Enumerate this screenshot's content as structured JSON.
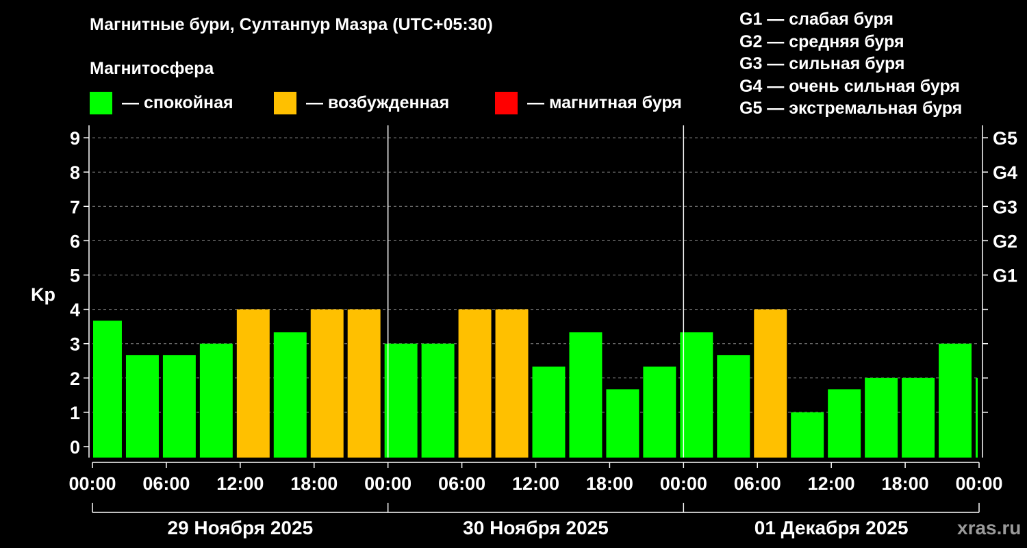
{
  "title": "Магнитные бури, Султанпур Мазра (UTC+05:30)",
  "subtitle": "Магнитосфера",
  "legend": [
    {
      "color": "#00ff00",
      "label": "— спокойная"
    },
    {
      "color": "#ffc000",
      "label": "— возбужденная"
    },
    {
      "color": "#ff0000",
      "label": "— магнитная буря"
    }
  ],
  "g_legend": [
    "G1 — слабая буря",
    "G2 — средняя буря",
    "G3 — сильная буря",
    "G4 — очень сильная буря",
    "G5 — экстремальная буря"
  ],
  "source": "xras.ru",
  "chart_data": {
    "type": "bar",
    "ylabel": "Kp",
    "ylim": [
      0,
      9
    ],
    "yticks": [
      "0",
      "1",
      "2",
      "3",
      "4",
      "5",
      "6",
      "7",
      "8",
      "9"
    ],
    "right_ticks": [
      {
        "value": 5,
        "label": "G1"
      },
      {
        "value": 6,
        "label": "G2"
      },
      {
        "value": 7,
        "label": "G3"
      },
      {
        "value": 8,
        "label": "G4"
      },
      {
        "value": 9,
        "label": "G5"
      }
    ],
    "grid": "horizontal dashed at each Kp level above 0",
    "xtick_labels": [
      "00:00",
      "06:00",
      "12:00",
      "18:00",
      "00:00",
      "06:00",
      "12:00",
      "18:00",
      "00:00",
      "06:00",
      "12:00",
      "18:00",
      "00:00"
    ],
    "days": [
      "29 Ноября 2025",
      "30 Ноября 2025",
      "01 Декабря 2025"
    ],
    "bars": [
      {
        "start": "29 Ноября 2025 00:00",
        "kp": 3.67,
        "status": "спокойная"
      },
      {
        "start": "29 Ноября 2025 02:30",
        "kp": 2.67,
        "status": "спокойная"
      },
      {
        "start": "29 Ноября 2025 05:30",
        "kp": 2.67,
        "status": "спокойная"
      },
      {
        "start": "29 Ноября 2025 08:30",
        "kp": 3.0,
        "status": "спокойная"
      },
      {
        "start": "29 Ноября 2025 11:30",
        "kp": 4.0,
        "status": "возбужденная"
      },
      {
        "start": "29 Ноября 2025 14:30",
        "kp": 3.33,
        "status": "спокойная"
      },
      {
        "start": "29 Ноября 2025 17:30",
        "kp": 4.0,
        "status": "возбужденная"
      },
      {
        "start": "29 Ноября 2025 20:30",
        "kp": 4.0,
        "status": "возбужденная"
      },
      {
        "start": "29 Ноября 2025 23:30",
        "kp": 3.0,
        "status": "спокойная"
      },
      {
        "start": "30 Ноября 2025 02:30",
        "kp": 3.0,
        "status": "спокойная"
      },
      {
        "start": "30 Ноября 2025 05:30",
        "kp": 4.0,
        "status": "возбужденная"
      },
      {
        "start": "30 Ноября 2025 08:30",
        "kp": 4.0,
        "status": "возбужденная"
      },
      {
        "start": "30 Ноября 2025 11:30",
        "kp": 2.33,
        "status": "спокойная"
      },
      {
        "start": "30 Ноября 2025 14:30",
        "kp": 3.33,
        "status": "спокойная"
      },
      {
        "start": "30 Ноября 2025 17:30",
        "kp": 1.67,
        "status": "спокойная"
      },
      {
        "start": "30 Ноября 2025 20:30",
        "kp": 2.33,
        "status": "спокойная"
      },
      {
        "start": "30 Ноября 2025 23:30",
        "kp": 3.33,
        "status": "спокойная"
      },
      {
        "start": "01 Декабря 2025 02:30",
        "kp": 2.67,
        "status": "спокойная"
      },
      {
        "start": "01 Декабря 2025 05:30",
        "kp": 4.0,
        "status": "возбужденная"
      },
      {
        "start": "01 Декабря 2025 08:30",
        "kp": 1.0,
        "status": "спокойная"
      },
      {
        "start": "01 Декабря 2025 11:30",
        "kp": 1.67,
        "status": "спокойная"
      },
      {
        "start": "01 Декабря 2025 14:30",
        "kp": 2.0,
        "status": "спокойная"
      },
      {
        "start": "01 Декабря 2025 17:30",
        "kp": 2.0,
        "status": "спокойная"
      },
      {
        "start": "01 Декабря 2025 20:30",
        "kp": 3.0,
        "status": "спокойная"
      },
      {
        "start": "01 Декабря 2025 23:30",
        "kp": 2.0,
        "status": "спокойная"
      }
    ]
  }
}
